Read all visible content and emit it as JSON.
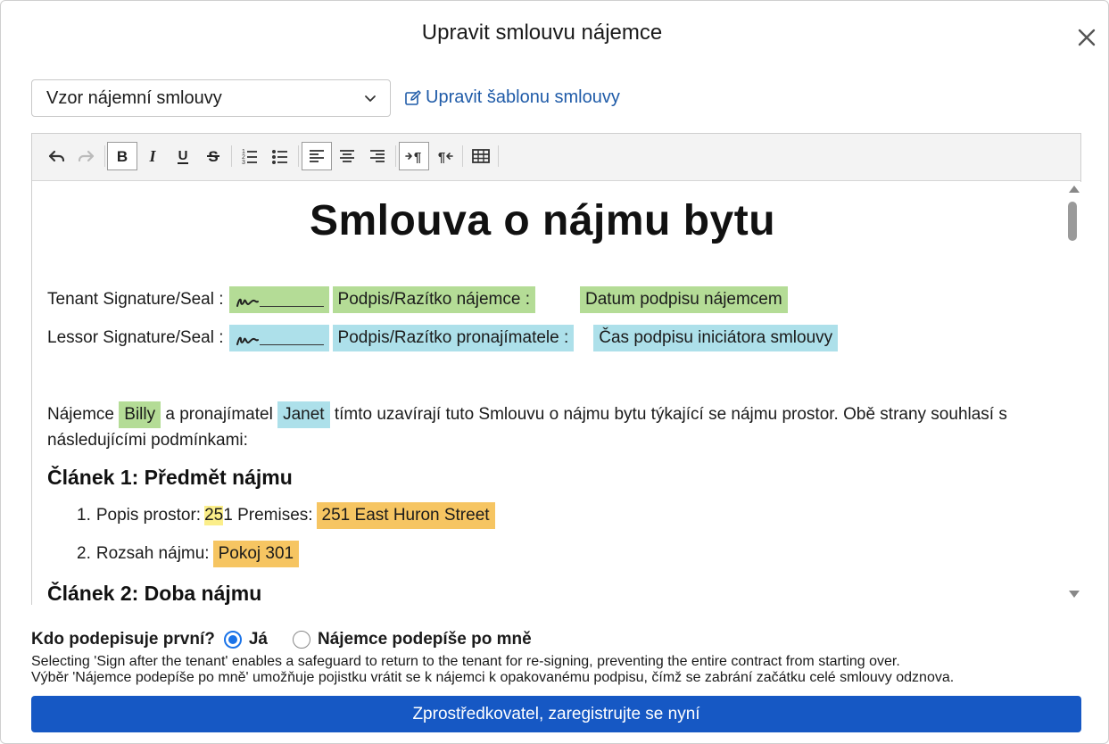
{
  "dialog": {
    "title": "Upravit smlouvu nájemce"
  },
  "template": {
    "selected": "Vzor nájemní smlouvy",
    "edit_link": "Upravit šablonu smlouvy"
  },
  "toolbar": {
    "buttons": [
      "undo",
      "redo",
      "bold",
      "italic",
      "underline",
      "strikethrough",
      "ordered-list",
      "bullet-list",
      "align-left",
      "align-center",
      "align-right",
      "ltr",
      "rtl",
      "table"
    ],
    "active": [
      "bold",
      "align-left",
      "ltr"
    ]
  },
  "document": {
    "title": "Smlouva o nájmu bytu",
    "tenant_sig_label": "Tenant Signature/Seal :",
    "tenant_sig_field": "Podpis/Razítko nájemce :",
    "tenant_date_field": "Datum podpisu nájemcem",
    "lessor_sig_label": "Lessor Signature/Seal :",
    "lessor_sig_field": "Podpis/Razítko pronajímatele :",
    "lessor_time_field": "Čas podpisu iniciátora smlouvy",
    "intro_1": "Nájemce",
    "tenant_name": "Billy",
    "intro_2": "a pronajímatel",
    "lessor_name": "Janet",
    "intro_3": "tímto uzavírají tuto Smlouvu o nájmu bytu týkající se nájmu prostor. Obě strany souhlasí s následujícími podmínkami:",
    "article1_title": "Článek 1: Předmět nájmu",
    "item1_num": "1.",
    "item1_label": "Popis prostor:",
    "item1_highlight": "25",
    "item1_rest": "1 Premises:",
    "item1_value": "251 East Huron Street",
    "item2_num": "2.",
    "item2_label": "Rozsah nájmu:",
    "item2_value": "Pokoj 301",
    "article2_title": "Článek 2: Doba nájmu"
  },
  "signing": {
    "question": "Kdo podepisuje první?",
    "option_me": "Já",
    "option_tenant_after": "Nájemce podepíše po mně",
    "selected": "Já",
    "help_en": "Selecting 'Sign after the tenant' enables a safeguard to return to the tenant for re-signing, preventing the entire contract from starting over.",
    "help_cs": "Výběr 'Nájemce podepíše po mně' umožňuje pojistku vrátit se k nájemci k opakovanému podpisu, čímž se zabrání začátku celé smlouvy odznova."
  },
  "primary_button": "Zprostředkovatel, zaregistrujte se nyní",
  "colors": {
    "tenant_field": "#b4dc96",
    "lessor_field": "#ade0ea",
    "value_field": "#f6c562",
    "primary": "#1658c4",
    "link": "#1f5ba8"
  }
}
